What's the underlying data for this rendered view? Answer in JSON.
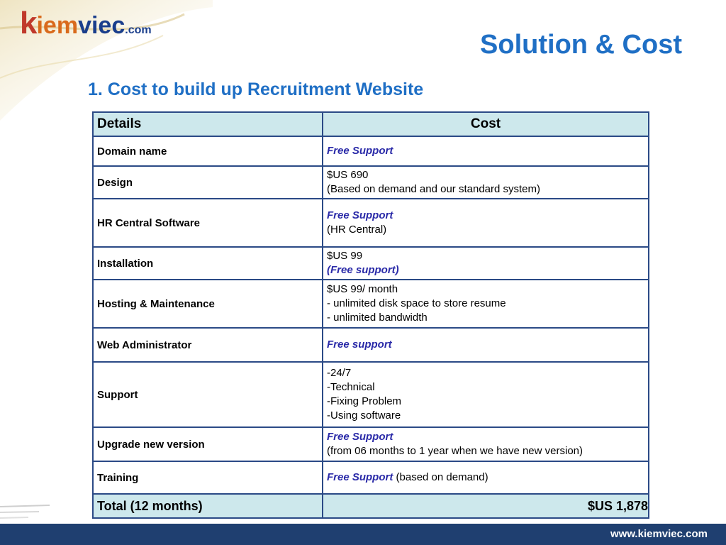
{
  "logo": {
    "k": "k",
    "iem": "iem",
    "viec": "viec",
    "com": ".com"
  },
  "title": "Solution & Cost",
  "subtitle": "1. Cost to build up Recruitment Website",
  "table": {
    "headers": {
      "details": "Details",
      "cost": "Cost"
    },
    "rows": [
      {
        "detail": "Domain name",
        "lines": [
          {
            "text": "Free Support",
            "free": true
          }
        ]
      },
      {
        "detail": "Design",
        "lines": [
          {
            "text": "$US 690",
            "free": false
          },
          {
            "text": "(Based on demand and our standard system)",
            "free": false
          }
        ]
      },
      {
        "detail": "HR Central Software",
        "lines": [
          {
            "text": "Free Support",
            "free": true
          },
          {
            "text": "(HR Central)",
            "free": false
          }
        ]
      },
      {
        "detail": "Installation",
        "lines": [
          {
            "text": "$US 99",
            "free": false
          },
          {
            "text": "(Free support)",
            "free": true
          }
        ]
      },
      {
        "detail": "Hosting & Maintenance",
        "lines": [
          {
            "text": "$US 99/ month",
            "free": false
          },
          {
            "text": "- unlimited disk space to store resume",
            "free": false
          },
          {
            "text": "- unlimited bandwidth",
            "free": false
          }
        ]
      },
      {
        "detail": "Web Administrator",
        "lines": [
          {
            "text": "Free support",
            "free": true
          }
        ]
      },
      {
        "detail": "Support",
        "lines": [
          {
            "text": "-24/7",
            "free": false
          },
          {
            "text": "-Technical",
            "free": false
          },
          {
            "text": "-Fixing Problem",
            "free": false
          },
          {
            "text": "-Using software",
            "free": false
          }
        ]
      },
      {
        "detail": "Upgrade new version",
        "lines": [
          {
            "text": "Free Support",
            "free": true
          },
          {
            "text": "(from 06 months to 1 year when we have new version)",
            "free": false
          }
        ]
      },
      {
        "detail": "Training",
        "lines": [
          {
            "text": "Free Support",
            "free": true,
            "suffix": " (based on demand)"
          }
        ]
      }
    ],
    "total": {
      "label": "Total (12 months)",
      "value": "$US 1,878"
    }
  },
  "footer": {
    "url": "www.kiemviec.com"
  },
  "colors": {
    "title": "#1f6fc5",
    "header_bg": "#cde8ec",
    "border": "#2b4a86",
    "free_text": "#2a2aa8",
    "footer_bg": "#1f3f70"
  }
}
